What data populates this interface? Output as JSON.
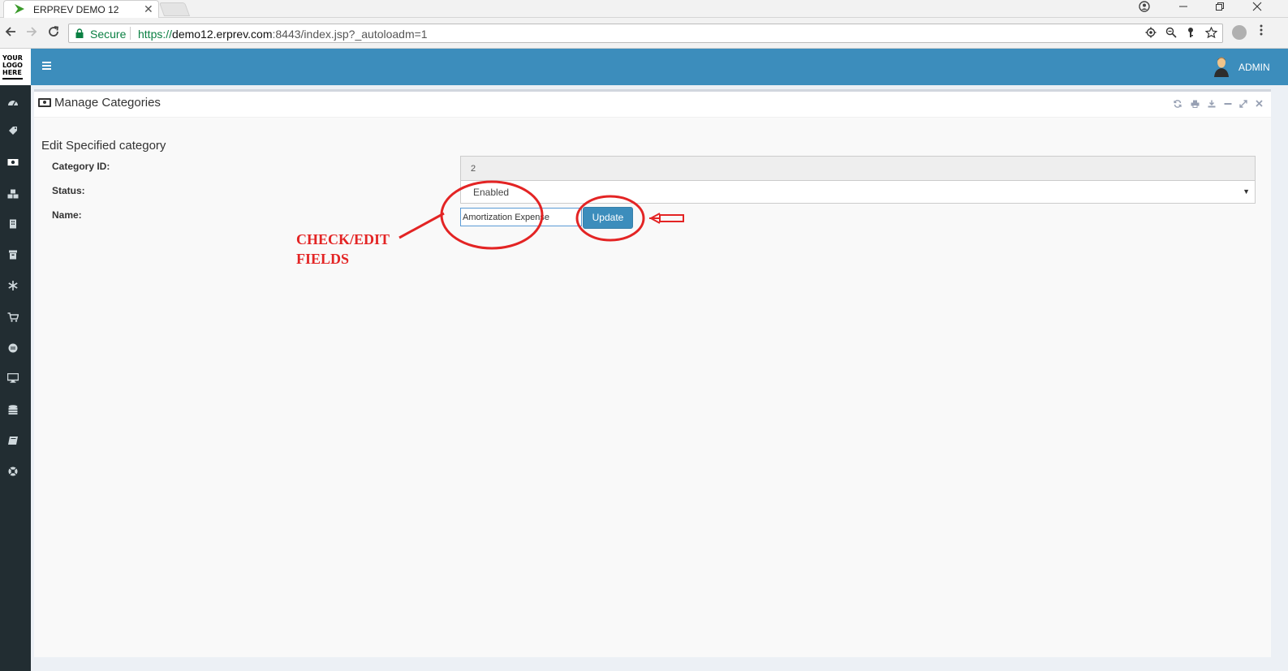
{
  "browser": {
    "tab_title": "ERPREV DEMO 12",
    "tab_close": "✕",
    "secure_label": "Secure",
    "url_scheme": "https://",
    "url_host": "demo12.erprev.com",
    "url_rest": ":8443/index.jsp?_autoloadm=1"
  },
  "app": {
    "logo_lines": [
      "YOUR",
      "LOGO",
      "HERE"
    ],
    "user_label": "ADMIN",
    "accent_color": "#3c8dbc"
  },
  "sidebar": {
    "icons": [
      "dashboard-icon",
      "tag-icon",
      "money-icon",
      "cubes-icon",
      "building-icon",
      "archive-icon",
      "snowflake-icon",
      "cart-icon",
      "circle-icon",
      "desktop-icon",
      "database-icon",
      "book-icon",
      "support-icon"
    ]
  },
  "panel": {
    "title": "Manage Categories",
    "tools": [
      "refresh-icon",
      "print-icon",
      "download-icon",
      "minimize-icon",
      "expand-icon",
      "close-icon"
    ]
  },
  "form": {
    "title": "Edit Specified category",
    "category_id_label": "Category ID:",
    "category_id_value": "2",
    "status_label": "Status:",
    "status_value": "Enabled",
    "name_label": "Name:",
    "name_value": "Amortization Expense",
    "update_label": "Update"
  },
  "annotation": {
    "line1": "CHECK/EDIT",
    "line2": "FIELDS",
    "color": "#e32424"
  }
}
